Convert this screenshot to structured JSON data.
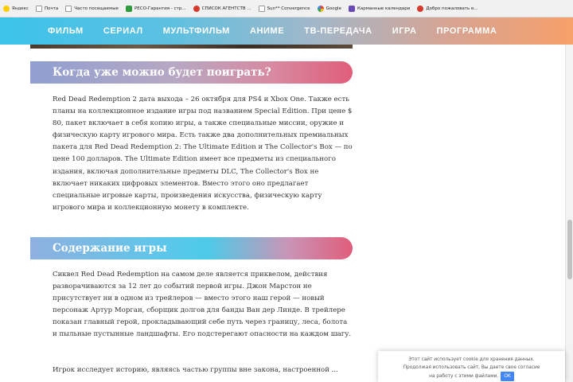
{
  "bookmarks": [
    {
      "label": "Яндекс",
      "icon": "yandex-icon"
    },
    {
      "label": "Почта",
      "icon": "page-icon"
    },
    {
      "label": "Часто посещаемые",
      "icon": "page-icon"
    },
    {
      "label": "РЕСО-Гарантия - стр...",
      "icon": "reso-icon"
    },
    {
      "label": "СПИСОК АГЕНТСТВ ...",
      "icon": "red-circle-icon"
    },
    {
      "label": "Sun** Convergence",
      "icon": "page-icon"
    },
    {
      "label": "Google",
      "icon": "google-icon"
    },
    {
      "label": "Карманные календари",
      "icon": "calendar-icon"
    },
    {
      "label": "Добро пожаловать в...",
      "icon": "red-circle-icon"
    }
  ],
  "nav": {
    "items": [
      "ФИЛЬМ",
      "СЕРИАЛ",
      "МУЛЬТФИЛЬМ",
      "АНИМЕ",
      "ТВ-ПЕРЕДАЧА",
      "ИГРА",
      "ПРОГРАММА"
    ]
  },
  "article": {
    "section1": {
      "title": "Когда уже можно будет поиграть?",
      "text": "Red Dead Redemption 2 дата выхода – 26 октября для PS4 и Xbox One. Также есть планы на коллекционное издание игры под названием Special Edition. При цене $ 80, пакет включает в себя копию игры, а также специальные миссии, оружие и физическую карту игрового мира. Есть также два дополнительных премиальных пакета для Red Dead Redemption 2: The Ultimate Edition и The Collector's Box — по цене 100 долларов. The Ultimate Edition имеет все предметы из специального издания, включая дополнительные предметы DLC, The Collector's Box не включает никаких цифровых элементов. Вместо этого оно предлагает специальные игровые карты, произведения искусства, физическую карту игрового мира и коллекционную монету в комплекте."
    },
    "section2": {
      "title": "Содержание игры",
      "text1": "Сиквел Red Dead Redemption на самом деле является приквелом, действия разворачиваются за 12 лет до событий первой игры. Джон Марстон не присутствует ни в одном из трейлеров — вместо этого наш герой — новый персонаж Артур Морган, сборщик долгов для банды Ван дер Линде. В трейлере показан главный герой, прокладывающий себе путь через границу, леса, болота и пыльные пустынные ландшафты. Его подстерегают опасности на каждом шагу.",
      "text2": "Игрок исследует историю, являясь частью группы вне закона, настроенной ..."
    }
  },
  "cookie": {
    "line1": "Этот сайт использует cookie для хранения данных.",
    "line2": "Продолжая использовать сайт, Вы даете свое согласие",
    "line3": "на работу с этими файлами.",
    "ok": "OK"
  },
  "colors": {
    "nav_start": "#3bc3ea",
    "nav_end": "#f7a069",
    "heading_end": "#e05e7b",
    "cookie_button": "#4285f4"
  }
}
